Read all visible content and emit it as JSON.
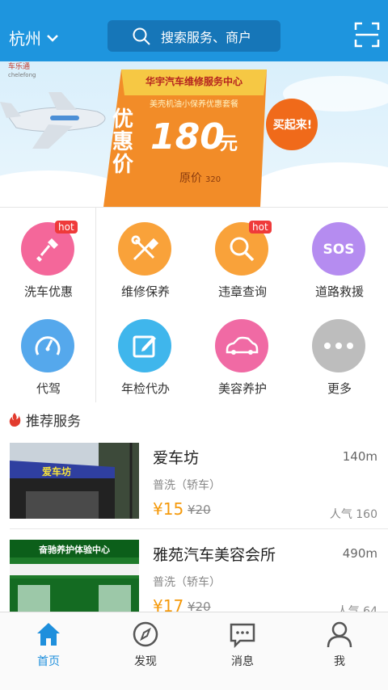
{
  "header": {
    "city": "杭州",
    "search_placeholder": "搜索服务、商户",
    "icons": [
      "chevron-down-icon",
      "search-icon",
      "scan-icon"
    ]
  },
  "banner": {
    "brand": "车乐通",
    "brand_en": "chelefong",
    "ribbon": "华宇汽车维修服务中心",
    "subtitle": "美壳机油小保养优惠套餐",
    "youhui": "优惠价",
    "price": "180",
    "unit": "元",
    "original_label": "原价",
    "original_value": "320",
    "buy": "买起来!"
  },
  "services": [
    {
      "label": "洗车优惠",
      "icon": "brush-icon",
      "color": "#f4679a",
      "hot": "hot"
    },
    {
      "label": "维修保养",
      "icon": "tools-icon",
      "color": "#f9a23a",
      "hot": ""
    },
    {
      "label": "违章查询",
      "icon": "magnifier-icon",
      "color": "#f9a23a",
      "hot": "hot"
    },
    {
      "label": "道路救援",
      "icon": "sos-icon",
      "color": "#b58cf0",
      "hot": ""
    },
    {
      "label": "代驾",
      "icon": "gauge-icon",
      "color": "#55a8ec",
      "hot": ""
    },
    {
      "label": "年检代办",
      "icon": "edit-icon",
      "color": "#3fb6ec",
      "hot": ""
    },
    {
      "label": "美容养护",
      "icon": "car-icon",
      "color": "#f06aa4",
      "hot": ""
    },
    {
      "label": "更多",
      "icon": "more-icon",
      "color": "#bdbdbd",
      "hot": ""
    }
  ],
  "recommend": {
    "title": "推荐服务",
    "items": [
      {
        "name": "爱车坊",
        "distance": "140m",
        "type": "普洗（轿车）",
        "price": "¥15",
        "old_price": "¥20",
        "popularity": "人气 160",
        "sign": "爱车坊"
      },
      {
        "name": "雅苑汽车美容会所",
        "distance": "490m",
        "type": "普洗（轿车）",
        "price": "¥17",
        "old_price": "¥20",
        "popularity": "人气 64",
        "sign": "奋驰养护体验中心"
      }
    ]
  },
  "tabbar": [
    {
      "label": "首页",
      "icon": "home-icon",
      "active": true
    },
    {
      "label": "发现",
      "icon": "compass-icon",
      "active": false
    },
    {
      "label": "消息",
      "icon": "message-icon",
      "active": false
    },
    {
      "label": "我",
      "icon": "user-icon",
      "active": false
    }
  ],
  "colors": {
    "primary": "#1e95de",
    "price": "#f59a0c",
    "hot": "#ef3a3a"
  }
}
